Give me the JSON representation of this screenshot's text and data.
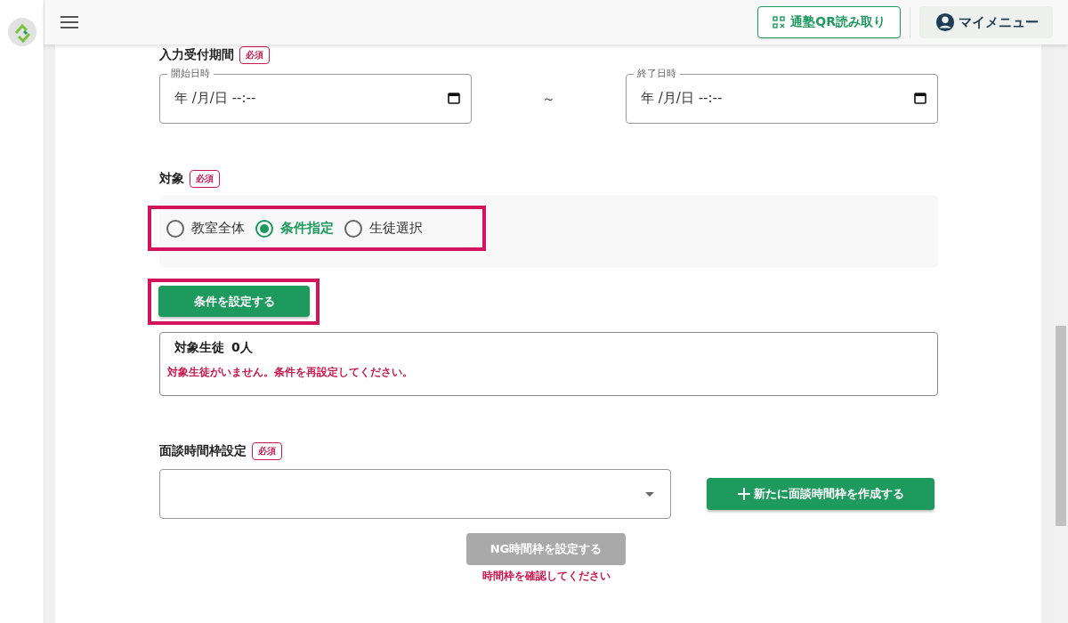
{
  "header": {
    "qr_button": "通塾QR読み取り",
    "my_menu": "マイメニュー"
  },
  "period": {
    "label": "入力受付期間",
    "required": "必須",
    "separator": "～",
    "fields": [
      {
        "label": "開始日時",
        "value": "年 /月/日 --:--"
      },
      {
        "label": "終了日時",
        "value": "年 /月/日 --:--"
      }
    ]
  },
  "target": {
    "label": "対象",
    "required": "必須",
    "options": [
      {
        "label": "教室全体",
        "selected": false
      },
      {
        "label": "条件指定",
        "selected": true
      },
      {
        "label": "生徒選択",
        "selected": false
      }
    ],
    "set_button": "条件を設定する",
    "summary": {
      "title": "対象生徒",
      "count": "0人",
      "message": "対象生徒がいません。条件を再設定してください。"
    }
  },
  "slot": {
    "label": "面談時間枠設定",
    "required": "必須",
    "create_button": "新たに面談時間枠を作成する",
    "ng_button": {
      "label": "NG時間枠を設定する",
      "disabled": true
    },
    "hint": "時間枠を確認してください"
  }
}
